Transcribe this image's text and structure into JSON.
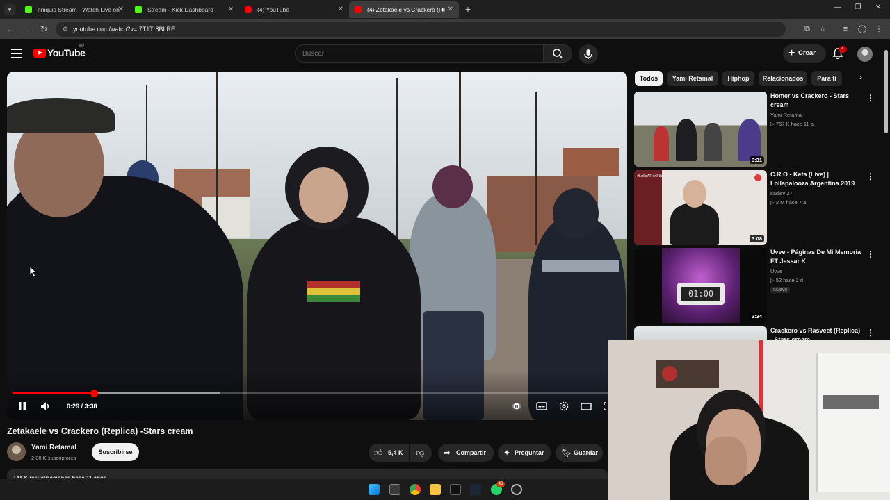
{
  "browser": {
    "tabs": [
      {
        "title": "nniquis Stream - Watch Live on",
        "favicon": "kick-icon",
        "active": false
      },
      {
        "title": "Stream - Kick Dashboard",
        "favicon": "kick-icon",
        "active": false
      },
      {
        "title": "(4) YouTube",
        "favicon": "youtube-icon",
        "active": false
      },
      {
        "title": "(4) Zetakaele vs Crackero (R",
        "favicon": "youtube-icon",
        "active": true
      }
    ],
    "url": "youtube.com/watch?v=I7T1Tr8BLRE"
  },
  "header": {
    "logo_text": "YouTube",
    "country_code": "AR",
    "search_placeholder": "Buscar",
    "create_label": "Crear",
    "notification_count": "4"
  },
  "player": {
    "time_current": "0:29",
    "time_total": "3:38",
    "time_separator": " / ",
    "progress_fraction": 0.133,
    "buffer_fraction": 0.34,
    "state": "playing"
  },
  "video": {
    "title": "Zetakaele vs Crackero (Replica) -Stars cream",
    "channel": "Yami Retamal",
    "subscribers": "2,08 K suscriptores",
    "subscribe_label": "Suscribirse",
    "likes": "5,4 K",
    "share_label": "Compartir",
    "ask_label": "Preguntar",
    "save_label": "Guardar",
    "views_line": "144 K visualizaciones  hace 11 años"
  },
  "sidebar": {
    "chips": [
      "Todos",
      "Yami Retamal",
      "Hiphop",
      "Relacionados",
      "Para ti"
    ],
    "recommendations": [
      {
        "title": "Homer vs Crackero - Stars cream",
        "channel": "Yami Retamal",
        "views": "767 K",
        "age": "hace 11 a",
        "duration": "3:31",
        "badge": ""
      },
      {
        "title": "C.R.O - Keta (Live) | Lollapalooza Argentina 2019",
        "channel": "sadlsv 27",
        "views": "2 M",
        "age": "hace 7 a",
        "duration": "3:08",
        "badge": ""
      },
      {
        "title": "Uvve - Páginas De Mi Memoria FT Jessar K",
        "channel": "Uvve",
        "views": "52",
        "age": "hace 2 d",
        "duration": "3:34",
        "badge": "Nuevo"
      },
      {
        "title": "Crackero vs Rasveet (Replica) - Stars cream",
        "channel": "",
        "views": "",
        "age": "",
        "duration": "",
        "badge": ""
      }
    ],
    "thumb_text_2": "#LollaARenFilo",
    "thumb_text_3": "01:00"
  },
  "taskbar": {
    "whatsapp_badge": "46"
  },
  "colors": {
    "accent": "#ff0000",
    "kick": "#53fc18",
    "background": "#0f0f0f",
    "chip": "#272727"
  }
}
